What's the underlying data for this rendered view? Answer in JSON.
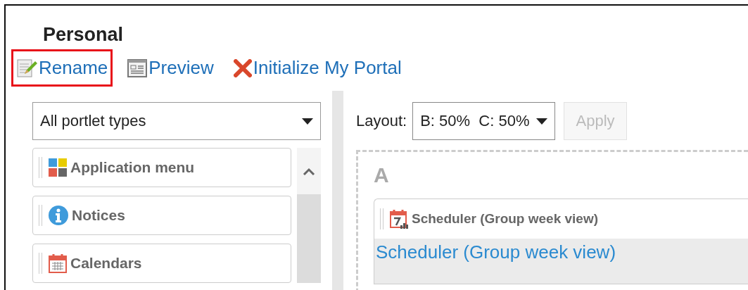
{
  "page_title": "Personal",
  "actions": [
    {
      "kind": "rename",
      "label": "Rename",
      "highlighted": true
    },
    {
      "kind": "preview",
      "label": "Preview",
      "highlighted": false
    },
    {
      "kind": "initialize",
      "label": "Initialize My Portal",
      "highlighted": false
    }
  ],
  "portlet_filter": {
    "value": "All portlet types"
  },
  "portlet_types": [
    {
      "kind": "apps",
      "label": "Application menu"
    },
    {
      "kind": "info",
      "label": "Notices"
    },
    {
      "kind": "calendar",
      "label": "Calendars"
    }
  ],
  "layout": {
    "label": "Layout:",
    "value": "B: 50%  C: 50%",
    "apply": {
      "label": "Apply",
      "disabled": true
    }
  },
  "area": {
    "name": "A",
    "portlets": [
      {
        "kind": "scheduler",
        "title": "Scheduler (Group week view)",
        "link": "Scheduler (Group week view)"
      }
    ]
  }
}
